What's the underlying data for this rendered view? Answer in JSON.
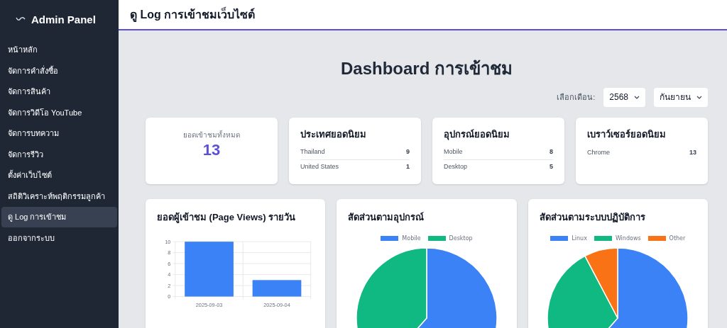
{
  "sidebar": {
    "title": "Admin Panel",
    "items": [
      {
        "label": "หน้าหลัก",
        "selected": false
      },
      {
        "label": "จัดการคำสั่งซื้อ",
        "selected": false
      },
      {
        "label": "จัดการสินค้า",
        "selected": false
      },
      {
        "label": "จัดการวิดีโอ YouTube",
        "selected": false
      },
      {
        "label": "จัดการบทความ",
        "selected": false
      },
      {
        "label": "จัดการรีวิว",
        "selected": false
      },
      {
        "label": "ตั้งค่าเว็บไซต์",
        "selected": false
      },
      {
        "label": "สถิติวิเคราะห์พฤติกรรมลูกค้า",
        "selected": false
      },
      {
        "label": "ดู Log การเข้าชม",
        "selected": true
      },
      {
        "label": "ออกจากระบบ",
        "selected": false
      }
    ]
  },
  "header": {
    "title": "ดู Log การเข้าชมเว็บไซต์"
  },
  "page_title": "Dashboard การเข้าชม",
  "filter": {
    "label": "เลือกเดือน:",
    "year": "2568",
    "month": "กันยายน"
  },
  "total": {
    "label": "ยอดเข้าชมทั้งหมด",
    "value": "13"
  },
  "stat_cards": [
    {
      "title": "ประเทศยอดนิยม",
      "rows": [
        {
          "name": "Thailand",
          "count": "9"
        },
        {
          "name": "United States",
          "count": "1"
        }
      ]
    },
    {
      "title": "อุปกรณ์ยอดนิยม",
      "rows": [
        {
          "name": "Mobile",
          "count": "8"
        },
        {
          "name": "Desktop",
          "count": "5"
        }
      ]
    },
    {
      "title": "เบราว์เซอร์ยอดนิยม",
      "rows": [
        {
          "name": "Chrome",
          "count": "13"
        }
      ]
    }
  ],
  "charts": [
    {
      "title": "ยอดผู้เข้าชม (Page Views) รายวัน",
      "chart_data": {
        "type": "bar",
        "categories": [
          "2025-09-03",
          "2025-09-04"
        ],
        "series": [
          {
            "color": "#3b82f6",
            "values": [
              10,
              3
            ]
          }
        ],
        "ylim": [
          0,
          10
        ],
        "yticks": [
          0,
          2,
          4,
          6,
          8,
          10
        ],
        "grid": true
      }
    },
    {
      "title": "สัดส่วนตามอุปกรณ์",
      "chart_data": {
        "type": "pie",
        "categories": [
          "Mobile",
          "Desktop"
        ],
        "values": [
          61.5,
          38.5
        ],
        "colors": [
          "#3b82f6",
          "#10b981"
        ]
      }
    },
    {
      "title": "สัดส่วนตามระบบปฏิบัติการ",
      "chart_data": {
        "type": "pie",
        "categories": [
          "Linux",
          "Windows",
          "Other"
        ],
        "values": [
          61.5,
          30.8,
          7.7
        ],
        "colors": [
          "#3b82f6",
          "#10b981",
          "#f97316"
        ]
      }
    }
  ]
}
